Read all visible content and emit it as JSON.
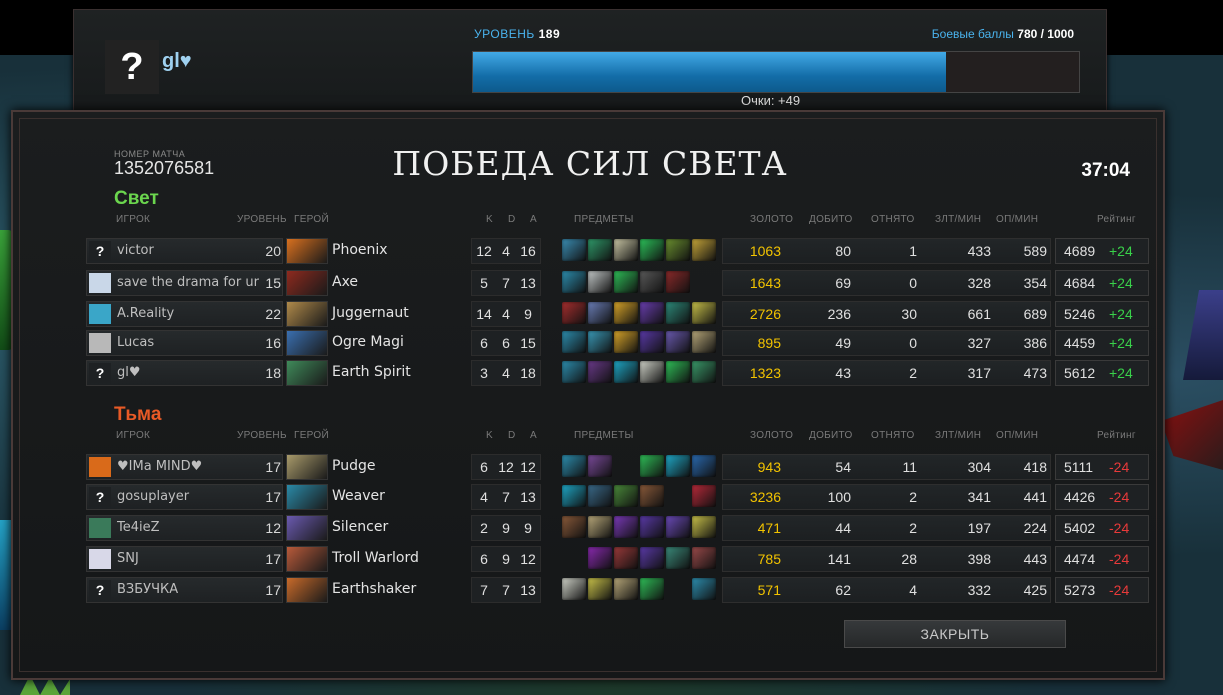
{
  "header": {
    "player_name": "gl♥",
    "avatar_symbol": "?",
    "level_label": "УРОВЕНЬ",
    "level_value": "189",
    "battle_points_label": "Боевые баллы",
    "battle_points_value": "780 / 1000",
    "battle_points_progress": 0.78,
    "points_label": "Очки: +49"
  },
  "match": {
    "id_label": "НОМЕР МАТЧА",
    "id": "1352076581",
    "result_title": "ПОБЕДА СИЛ СВЕТА",
    "duration": "37:04"
  },
  "columns": {
    "player": "ИГРОК",
    "level": "УРОВЕНЬ",
    "hero": "ГЕРОЙ",
    "kills": "K",
    "deaths": "D",
    "assists": "A",
    "items": "ПРЕДМЕТЫ",
    "gold": "ЗОЛОТО",
    "last_hits": "ДОБИТО",
    "denies": "ОТНЯТО",
    "gpm": "ЗЛТ/МИН",
    "xpm": "ОП/МИН",
    "rating": "Рейтинг"
  },
  "teams": [
    {
      "name": "Свет",
      "players": [
        {
          "avatar": "?",
          "avatar_color": "#1e2123",
          "name": "victor",
          "level": "20",
          "hero": "Phoenix",
          "hero_color": "#d8701f",
          "k": "12",
          "d": "4",
          "a": "16",
          "items": [
            "#3b8fb5",
            "#2f9a6a",
            "#c9c6a5",
            "#2cc25a",
            "#6a8f2f",
            "#c7a63a"
          ],
          "gold": "1063",
          "last_hits": "80",
          "denies": "1",
          "gpm": "433",
          "xpm": "589",
          "rating": "4689",
          "delta": "+24"
        },
        {
          "avatar": "",
          "avatar_color": "#c9d7e8",
          "name": "save the drama for ur mom",
          "level": "15",
          "hero": "Axe",
          "hero_color": "#8e2a1e",
          "k": "5",
          "d": "7",
          "a": "13",
          "items": [
            "#2d8fb0",
            "#c2c7c7",
            "#2fbf58",
            "#5a5a5a",
            "#8b2a2a",
            ""
          ],
          "gold": "1643",
          "last_hits": "69",
          "denies": "0",
          "gpm": "328",
          "xpm": "354",
          "rating": "4684",
          "delta": "+24"
        },
        {
          "avatar": "",
          "avatar_color": "#3aa6c8",
          "name": "A.Reality",
          "level": "22",
          "hero": "Juggernaut",
          "hero_color": "#b08a4a",
          "k": "14",
          "d": "4",
          "a": "9",
          "items": [
            "#a82f2f",
            "#6b7fb8",
            "#d8a52a",
            "#6a3fb0",
            "#2d8a7a",
            "#c9c24a"
          ],
          "gold": "2726",
          "last_hits": "236",
          "denies": "30",
          "gpm": "661",
          "xpm": "689",
          "rating": "5246",
          "delta": "+24"
        },
        {
          "avatar": "",
          "avatar_color": "#b8b8b8",
          "name": "Lucas",
          "level": "16",
          "hero": "Ogre Magi",
          "hero_color": "#3a6fb0",
          "k": "6",
          "d": "6",
          "a": "15",
          "items": [
            "#2d8fb0",
            "#3a9ab8",
            "#d8a52a",
            "#5a3aa8",
            "#6a5ab0",
            "#b8a87a"
          ],
          "gold": "895",
          "last_hits": "49",
          "denies": "0",
          "gpm": "327",
          "xpm": "386",
          "rating": "4459",
          "delta": "+24"
        },
        {
          "avatar": "?",
          "avatar_color": "#1e2123",
          "name": "gl♥",
          "level": "18",
          "hero": "Earth Spirit",
          "hero_color": "#3f8a5a",
          "k": "3",
          "d": "4",
          "a": "18",
          "items": [
            "#2d8fb0",
            "#6a3a8a",
            "#1fa8c8",
            "#cfd2c8",
            "#2fbf58",
            "#3a9a6a"
          ],
          "gold": "1323",
          "last_hits": "43",
          "denies": "2",
          "gpm": "317",
          "xpm": "473",
          "rating": "5612",
          "delta": "+24"
        }
      ]
    },
    {
      "name": "Тьма",
      "players": [
        {
          "avatar": "",
          "avatar_color": "#d96a1a",
          "name": "♥IMa MIND♥",
          "level": "17",
          "hero": "Pudge",
          "hero_color": "#a89a6a",
          "k": "6",
          "d": "12",
          "a": "12",
          "items": [
            "#2d8fb0",
            "#7a4a9a",
            "",
            "#2fbf58",
            "#1fa8c8",
            "#2a6ab0"
          ],
          "gold": "943",
          "last_hits": "54",
          "denies": "11",
          "gpm": "304",
          "xpm": "418",
          "rating": "5111",
          "delta": "-24"
        },
        {
          "avatar": "?",
          "avatar_color": "#1e2123",
          "name": "gosuplayer",
          "level": "17",
          "hero": "Weaver",
          "hero_color": "#2a8aa8",
          "k": "4",
          "d": "7",
          "a": "13",
          "items": [
            "#1fa8c8",
            "#3a6a8a",
            "#4a8a3a",
            "#8a5a3a",
            "",
            "#b82a3a"
          ],
          "gold": "3236",
          "last_hits": "100",
          "denies": "2",
          "gpm": "341",
          "xpm": "441",
          "rating": "4426",
          "delta": "-24"
        },
        {
          "avatar": "",
          "avatar_color": "#3a7a5a",
          "name": "Te4ieZ",
          "level": "12",
          "hero": "Silencer",
          "hero_color": "#6a5ab0",
          "k": "2",
          "d": "9",
          "a": "9",
          "items": [
            "#8a5a3a",
            "#b8a87a",
            "#7a3ab8",
            "#5a3aa8",
            "#6a4ab8",
            "#c9c24a"
          ],
          "gold": "471",
          "last_hits": "44",
          "denies": "2",
          "gpm": "197",
          "xpm": "224",
          "rating": "5402",
          "delta": "-24"
        },
        {
          "avatar": "",
          "avatar_color": "#d8d8e8",
          "name": "SNJ",
          "level": "17",
          "hero": "Troll Warlord",
          "hero_color": "#b85a3a",
          "k": "6",
          "d": "9",
          "a": "12",
          "items": [
            "",
            "#8a2ab0",
            "#9a3a3a",
            "#5a3aa8",
            "#3a8a7a",
            "#9a4a4a"
          ],
          "gold": "785",
          "last_hits": "141",
          "denies": "28",
          "gpm": "398",
          "xpm": "443",
          "rating": "4474",
          "delta": "-24"
        },
        {
          "avatar": "?",
          "avatar_color": "#1e2123",
          "name": "ВЗБУЧКА",
          "level": "17",
          "hero": "Earthshaker",
          "hero_color": "#c86a2a",
          "k": "7",
          "d": "7",
          "a": "13",
          "items": [
            "#cfd2c8",
            "#c9c24a",
            "#b8a87a",
            "#2fbf58",
            "",
            "#2d8fb0"
          ],
          "gold": "571",
          "last_hits": "62",
          "denies": "4",
          "gpm": "332",
          "xpm": "425",
          "rating": "5273",
          "delta": "-24"
        }
      ]
    }
  ],
  "close_button": "ЗАКРЫТЬ"
}
